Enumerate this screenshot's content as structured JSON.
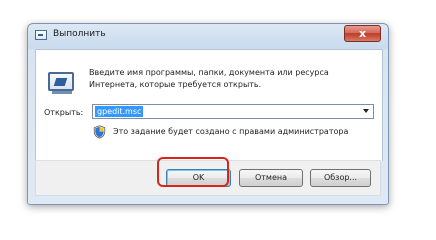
{
  "window": {
    "title": "Выполнить",
    "close_glyph": "x",
    "title_icon": "run-icon"
  },
  "dialog": {
    "description": "Введите имя программы, папки, документа или ресурса Интернета, которые требуется открыть.",
    "open_label": "Открыть:",
    "open_value": "gpedit.msc",
    "admin_note": "Это задание будет создано с правами администратора",
    "run_icon": "run-icon",
    "shield_icon": "admin-shield-icon"
  },
  "buttons": {
    "ok": "OK",
    "cancel": "Отмена",
    "browse": "Обзор..."
  },
  "highlight": {
    "color": "#d9261c"
  }
}
